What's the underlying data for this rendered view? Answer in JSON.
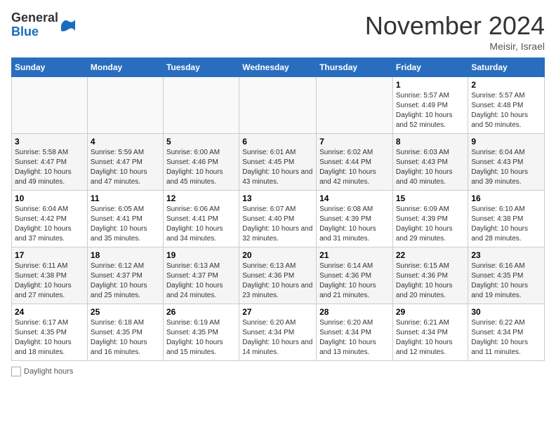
{
  "logo": {
    "general": "General",
    "blue": "Blue"
  },
  "title": "November 2024",
  "location": "Meisir, Israel",
  "days_of_week": [
    "Sunday",
    "Monday",
    "Tuesday",
    "Wednesday",
    "Thursday",
    "Friday",
    "Saturday"
  ],
  "footer": {
    "box_label": "Daylight hours"
  },
  "weeks": [
    [
      {
        "day": "",
        "sunrise": "",
        "sunset": "",
        "daylight": ""
      },
      {
        "day": "",
        "sunrise": "",
        "sunset": "",
        "daylight": ""
      },
      {
        "day": "",
        "sunrise": "",
        "sunset": "",
        "daylight": ""
      },
      {
        "day": "",
        "sunrise": "",
        "sunset": "",
        "daylight": ""
      },
      {
        "day": "",
        "sunrise": "",
        "sunset": "",
        "daylight": ""
      },
      {
        "day": "1",
        "sunrise": "Sunrise: 5:57 AM",
        "sunset": "Sunset: 4:49 PM",
        "daylight": "Daylight: 10 hours and 52 minutes."
      },
      {
        "day": "2",
        "sunrise": "Sunrise: 5:57 AM",
        "sunset": "Sunset: 4:48 PM",
        "daylight": "Daylight: 10 hours and 50 minutes."
      }
    ],
    [
      {
        "day": "3",
        "sunrise": "Sunrise: 5:58 AM",
        "sunset": "Sunset: 4:47 PM",
        "daylight": "Daylight: 10 hours and 49 minutes."
      },
      {
        "day": "4",
        "sunrise": "Sunrise: 5:59 AM",
        "sunset": "Sunset: 4:47 PM",
        "daylight": "Daylight: 10 hours and 47 minutes."
      },
      {
        "day": "5",
        "sunrise": "Sunrise: 6:00 AM",
        "sunset": "Sunset: 4:46 PM",
        "daylight": "Daylight: 10 hours and 45 minutes."
      },
      {
        "day": "6",
        "sunrise": "Sunrise: 6:01 AM",
        "sunset": "Sunset: 4:45 PM",
        "daylight": "Daylight: 10 hours and 43 minutes."
      },
      {
        "day": "7",
        "sunrise": "Sunrise: 6:02 AM",
        "sunset": "Sunset: 4:44 PM",
        "daylight": "Daylight: 10 hours and 42 minutes."
      },
      {
        "day": "8",
        "sunrise": "Sunrise: 6:03 AM",
        "sunset": "Sunset: 4:43 PM",
        "daylight": "Daylight: 10 hours and 40 minutes."
      },
      {
        "day": "9",
        "sunrise": "Sunrise: 6:04 AM",
        "sunset": "Sunset: 4:43 PM",
        "daylight": "Daylight: 10 hours and 39 minutes."
      }
    ],
    [
      {
        "day": "10",
        "sunrise": "Sunrise: 6:04 AM",
        "sunset": "Sunset: 4:42 PM",
        "daylight": "Daylight: 10 hours and 37 minutes."
      },
      {
        "day": "11",
        "sunrise": "Sunrise: 6:05 AM",
        "sunset": "Sunset: 4:41 PM",
        "daylight": "Daylight: 10 hours and 35 minutes."
      },
      {
        "day": "12",
        "sunrise": "Sunrise: 6:06 AM",
        "sunset": "Sunset: 4:41 PM",
        "daylight": "Daylight: 10 hours and 34 minutes."
      },
      {
        "day": "13",
        "sunrise": "Sunrise: 6:07 AM",
        "sunset": "Sunset: 4:40 PM",
        "daylight": "Daylight: 10 hours and 32 minutes."
      },
      {
        "day": "14",
        "sunrise": "Sunrise: 6:08 AM",
        "sunset": "Sunset: 4:39 PM",
        "daylight": "Daylight: 10 hours and 31 minutes."
      },
      {
        "day": "15",
        "sunrise": "Sunrise: 6:09 AM",
        "sunset": "Sunset: 4:39 PM",
        "daylight": "Daylight: 10 hours and 29 minutes."
      },
      {
        "day": "16",
        "sunrise": "Sunrise: 6:10 AM",
        "sunset": "Sunset: 4:38 PM",
        "daylight": "Daylight: 10 hours and 28 minutes."
      }
    ],
    [
      {
        "day": "17",
        "sunrise": "Sunrise: 6:11 AM",
        "sunset": "Sunset: 4:38 PM",
        "daylight": "Daylight: 10 hours and 27 minutes."
      },
      {
        "day": "18",
        "sunrise": "Sunrise: 6:12 AM",
        "sunset": "Sunset: 4:37 PM",
        "daylight": "Daylight: 10 hours and 25 minutes."
      },
      {
        "day": "19",
        "sunrise": "Sunrise: 6:13 AM",
        "sunset": "Sunset: 4:37 PM",
        "daylight": "Daylight: 10 hours and 24 minutes."
      },
      {
        "day": "20",
        "sunrise": "Sunrise: 6:13 AM",
        "sunset": "Sunset: 4:36 PM",
        "daylight": "Daylight: 10 hours and 23 minutes."
      },
      {
        "day": "21",
        "sunrise": "Sunrise: 6:14 AM",
        "sunset": "Sunset: 4:36 PM",
        "daylight": "Daylight: 10 hours and 21 minutes."
      },
      {
        "day": "22",
        "sunrise": "Sunrise: 6:15 AM",
        "sunset": "Sunset: 4:36 PM",
        "daylight": "Daylight: 10 hours and 20 minutes."
      },
      {
        "day": "23",
        "sunrise": "Sunrise: 6:16 AM",
        "sunset": "Sunset: 4:35 PM",
        "daylight": "Daylight: 10 hours and 19 minutes."
      }
    ],
    [
      {
        "day": "24",
        "sunrise": "Sunrise: 6:17 AM",
        "sunset": "Sunset: 4:35 PM",
        "daylight": "Daylight: 10 hours and 18 minutes."
      },
      {
        "day": "25",
        "sunrise": "Sunrise: 6:18 AM",
        "sunset": "Sunset: 4:35 PM",
        "daylight": "Daylight: 10 hours and 16 minutes."
      },
      {
        "day": "26",
        "sunrise": "Sunrise: 6:19 AM",
        "sunset": "Sunset: 4:35 PM",
        "daylight": "Daylight: 10 hours and 15 minutes."
      },
      {
        "day": "27",
        "sunrise": "Sunrise: 6:20 AM",
        "sunset": "Sunset: 4:34 PM",
        "daylight": "Daylight: 10 hours and 14 minutes."
      },
      {
        "day": "28",
        "sunrise": "Sunrise: 6:20 AM",
        "sunset": "Sunset: 4:34 PM",
        "daylight": "Daylight: 10 hours and 13 minutes."
      },
      {
        "day": "29",
        "sunrise": "Sunrise: 6:21 AM",
        "sunset": "Sunset: 4:34 PM",
        "daylight": "Daylight: 10 hours and 12 minutes."
      },
      {
        "day": "30",
        "sunrise": "Sunrise: 6:22 AM",
        "sunset": "Sunset: 4:34 PM",
        "daylight": "Daylight: 10 hours and 11 minutes."
      }
    ]
  ]
}
